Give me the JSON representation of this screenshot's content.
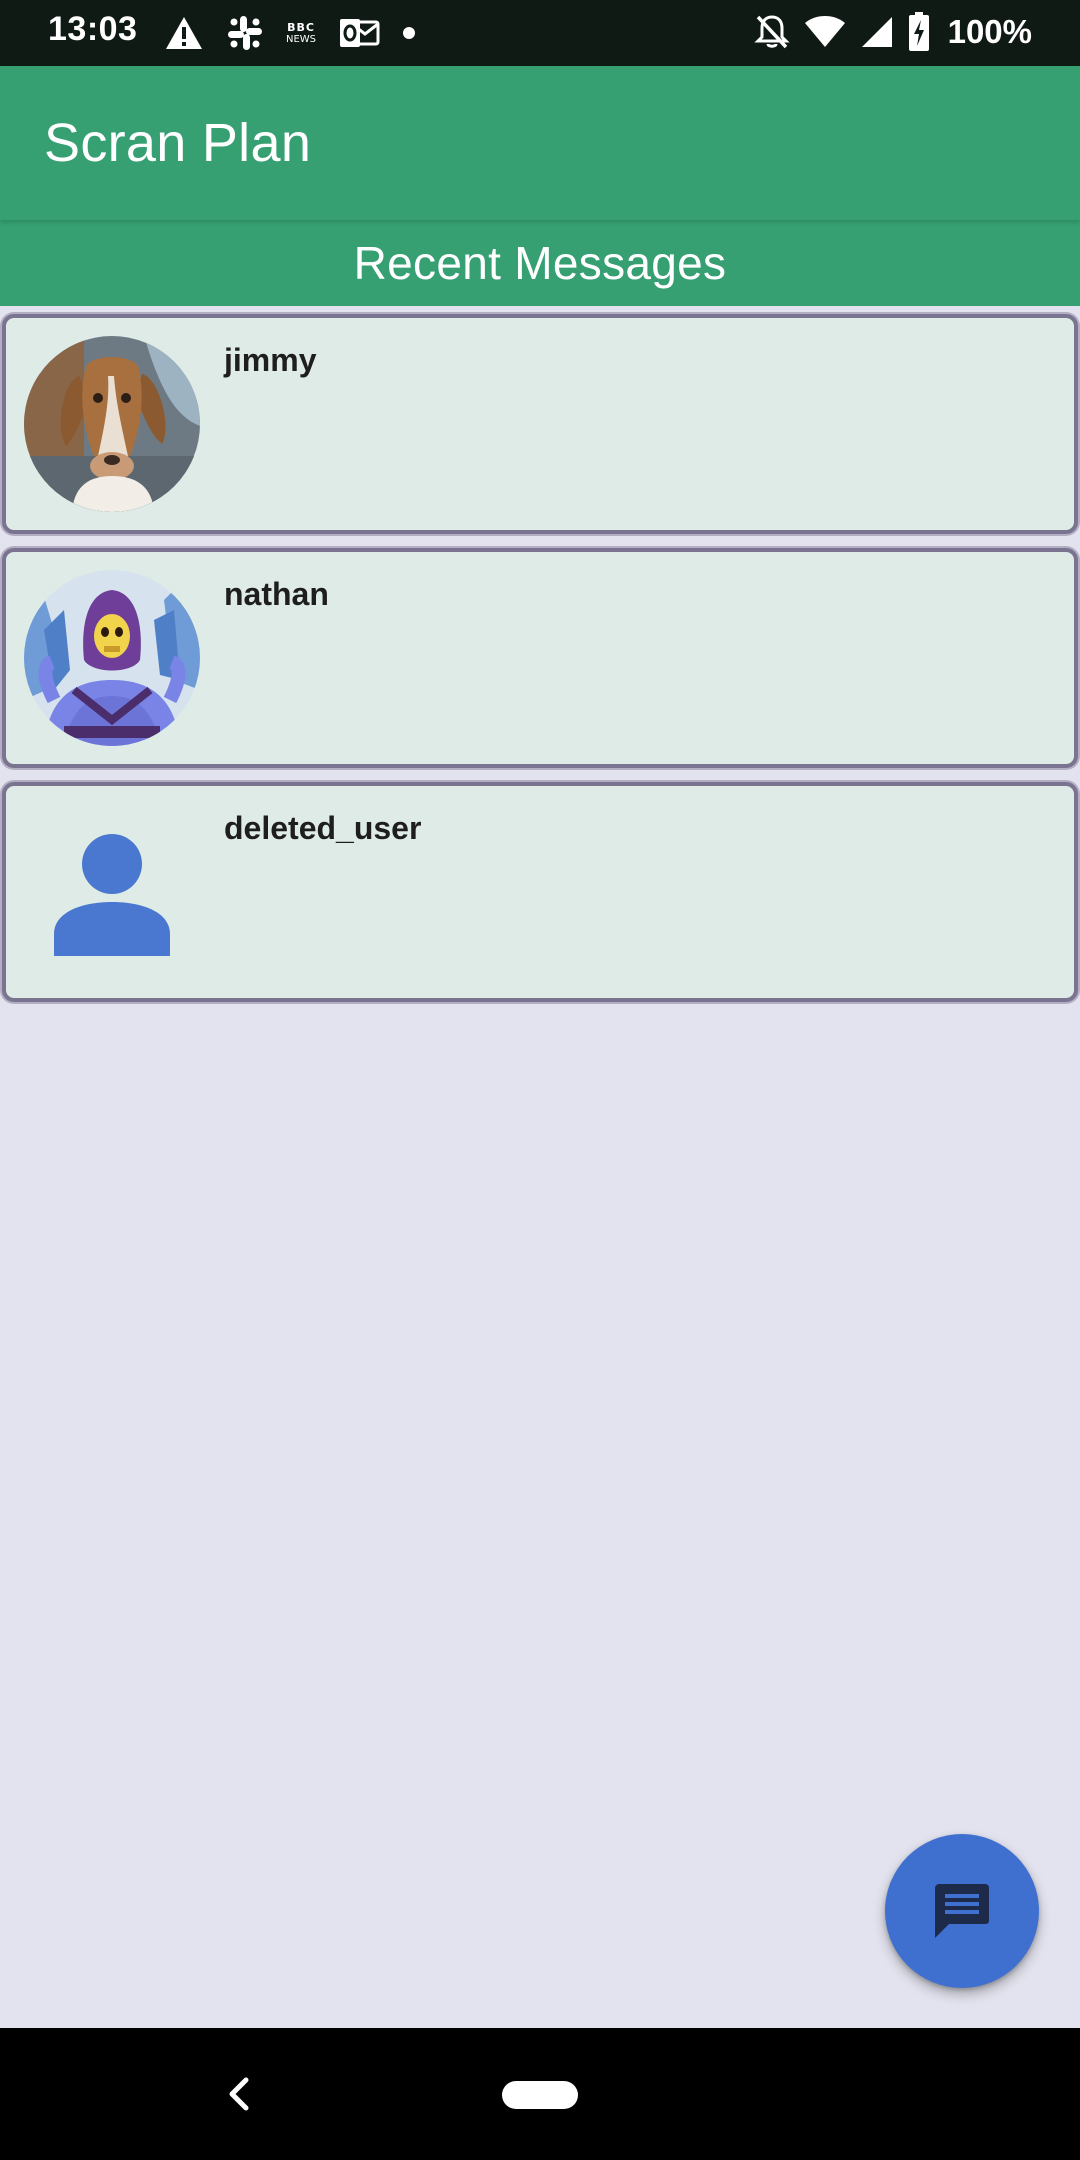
{
  "status_bar": {
    "time": "13:03",
    "left_icons": [
      "warning-icon",
      "slack-icon",
      "bbc-news-icon",
      "outlook-icon",
      "dot-icon"
    ],
    "bbc_label_top": "BBC",
    "bbc_label_bottom": "NEWS",
    "right_icons": [
      "notifications-off-icon",
      "wifi-icon",
      "signal-icon",
      "battery-charging-icon"
    ],
    "battery": "100%"
  },
  "app_bar": {
    "title": "Scran Plan"
  },
  "section": {
    "title": "Recent Messages"
  },
  "messages": [
    {
      "name": "jimmy",
      "avatar": "dog-photo"
    },
    {
      "name": "nathan",
      "avatar": "skeletor-cartoon"
    },
    {
      "name": "deleted_user",
      "avatar": "default-person-icon"
    }
  ],
  "fab": {
    "icon": "chat-message-icon"
  },
  "nav_bar": {
    "icons": [
      "back-icon",
      "home-pill"
    ]
  },
  "colors": {
    "primary": "#36A073",
    "status_bar": "#0F1A15",
    "background": "#E3E3EF",
    "card_background": "#DFEBE6",
    "card_border": "#7B7490",
    "fab": "#3F6FCF",
    "person_icon": "#4A78D0"
  }
}
